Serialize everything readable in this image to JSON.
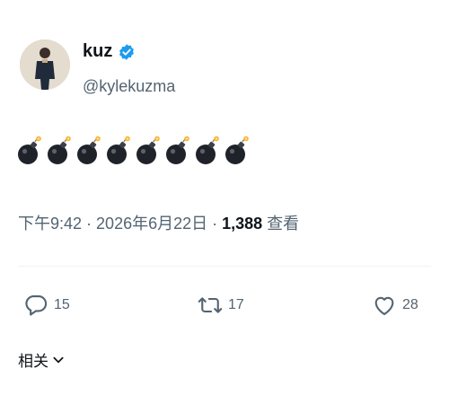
{
  "author": {
    "display_name": "kuz",
    "handle": "@kylekuzma",
    "verified": true,
    "avatar_icon": "profile-photo"
  },
  "tweet": {
    "emoji": [
      "bomb",
      "bomb",
      "bomb",
      "bomb",
      "bomb",
      "bomb",
      "bomb",
      "bomb"
    ]
  },
  "meta": {
    "time": "下午9:42",
    "separator": "·",
    "date": "2026年6月22日",
    "views_count": "1,388",
    "views_label": "查看"
  },
  "actions": {
    "reply_count": "15",
    "retweet_count": "17",
    "like_count": "28"
  },
  "related": {
    "label": "相关"
  },
  "colors": {
    "text": "#0f1419",
    "secondary": "#536471",
    "verified": "#1d9bf0",
    "divider": "#eff3f4"
  }
}
